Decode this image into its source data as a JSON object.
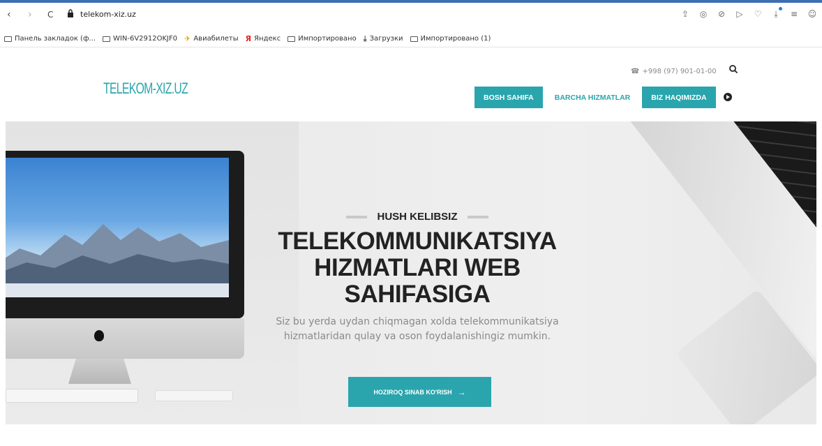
{
  "browser": {
    "url": "telekom-xiz.uz",
    "back_glyph": "‹",
    "forward_glyph": "›",
    "reload_glyph": "C",
    "toolbar_icons": [
      "share-icon",
      "camera-icon",
      "shield-icon",
      "play-icon",
      "heart-icon",
      "download-icon",
      "menu-icon",
      "profile-icon"
    ],
    "toolbar_glyphs": [
      "⇪",
      "◎",
      "⊘",
      "▷",
      "♡",
      "⤓",
      "≡",
      "☺"
    ]
  },
  "bookmarks": [
    {
      "label": "Панель закладок (ф...",
      "icon": "folder-icon"
    },
    {
      "label": "WIN-6V2912OKJF0",
      "icon": "folder-icon"
    },
    {
      "label": "Авиабилеты",
      "icon": "plane-icon",
      "glyph": "✈"
    },
    {
      "label": "Яндекс",
      "icon": "yandex-icon",
      "glyph": "Я"
    },
    {
      "label": "Импортировано",
      "icon": "folder-icon"
    },
    {
      "label": "Загрузки",
      "icon": "download-icon",
      "glyph": "⤓"
    },
    {
      "label": "Импортировано (1)",
      "icon": "folder-icon"
    }
  ],
  "site": {
    "logo": "TELEKOM-XIZ.UZ",
    "phone": "+998 (97) 901-01-00",
    "nav": [
      "BOSH SAHIFA",
      "BARCHA HIZMATLAR",
      "BIZ HAQIMIZDA"
    ]
  },
  "hero": {
    "eyebrow": "HUSH KELIBSIZ",
    "headline_line1": "TELEKOMMUNIKATSIYA",
    "headline_line2": "HIZMATLARI WEB",
    "headline_line3": "SAHIFASIGA",
    "subtext_line1": "Siz bu yerda uydan chiqmagan xolda telekommunikatsiya",
    "subtext_line2": "hizmatlaridan qulay va oson foydalanishingiz mumkin.",
    "cta_label": "HOZIROQ SINAB KO'RISH",
    "cta_arrow": "→"
  },
  "colors": {
    "accent": "#2aa5ad",
    "browser_strip": "#3c6fb4",
    "headline": "#222222",
    "subtext": "#8a8a8a"
  }
}
